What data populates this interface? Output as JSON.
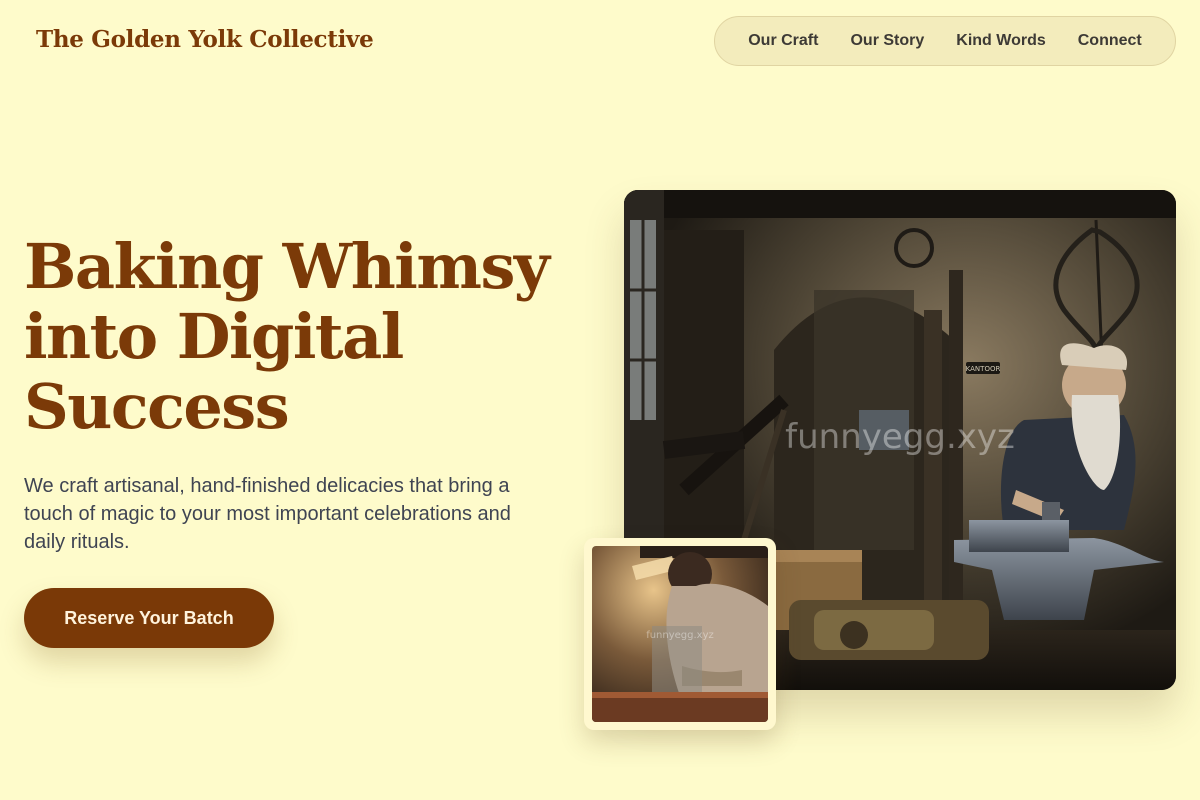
{
  "brand": {
    "name": "The Golden Yolk Collective"
  },
  "nav": {
    "items": [
      {
        "label": "Our Craft"
      },
      {
        "label": "Our Story"
      },
      {
        "label": "Kind Words"
      },
      {
        "label": "Connect"
      }
    ]
  },
  "hero": {
    "headline_line1": "Baking Whimsy",
    "headline_line2": "into Digital",
    "headline_line3": "Success",
    "description": "We craft artisanal, hand-finished delicacies that bring a touch of magic to your most important celebrations and daily rituals.",
    "cta_label": "Reserve Your Batch"
  },
  "images": {
    "main": {
      "watermark": "funnyegg.xyz",
      "sign": "KANTOOR"
    },
    "thumbnail": {
      "watermark": "funnyegg.xyz"
    }
  },
  "colors": {
    "background": "#fefbcb",
    "brand_brown": "#7b3a08",
    "nav_pill": "#f3ecbc",
    "body_text": "#3f4452"
  }
}
